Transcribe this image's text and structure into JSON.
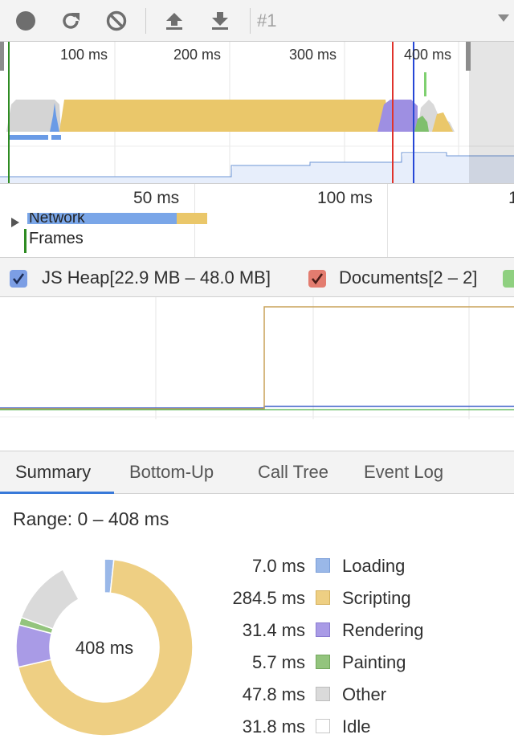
{
  "toolbar": {
    "recording_label": "#1",
    "buttons": [
      "record-icon",
      "reload-icon",
      "clear-icon",
      "upload-icon",
      "download-icon"
    ]
  },
  "overview": {
    "ticks": [
      "100 ms",
      "200 ms",
      "300 ms",
      "400 ms"
    ]
  },
  "flame": {
    "ticks": [
      "50 ms",
      "100 ms",
      "1"
    ],
    "network_label": "Network",
    "frames_label": "Frames"
  },
  "counters": {
    "js_heap": "JS Heap[22.9 MB – 48.0 MB]",
    "documents": "Documents[2 – 2]"
  },
  "tabs": [
    "Summary",
    "Bottom-Up",
    "Call Tree",
    "Event Log"
  ],
  "summary": {
    "range": "Range: 0 – 408 ms",
    "total": "408 ms",
    "items": [
      {
        "value": "7.0 ms",
        "label": "Loading",
        "ms": 7.0,
        "color": "#9ab8e8"
      },
      {
        "value": "284.5 ms",
        "label": "Scripting",
        "ms": 284.5,
        "color": "#eecf83"
      },
      {
        "value": "31.4 ms",
        "label": "Rendering",
        "ms": 31.4,
        "color": "#a99be6"
      },
      {
        "value": "5.7 ms",
        "label": "Painting",
        "ms": 5.7,
        "color": "#93c47d"
      },
      {
        "value": "47.8 ms",
        "label": "Other",
        "ms": 47.8,
        "color": "#dadada"
      },
      {
        "value": "31.8 ms",
        "label": "Idle",
        "ms": 31.8,
        "color": "#ffffff"
      }
    ]
  },
  "colors": {
    "scripting": "#eecf83",
    "loading": "#9ab8e8",
    "rendering": "#a99be6",
    "painting": "#93c47d",
    "other": "#dadada",
    "accent": "#3879d9"
  }
}
